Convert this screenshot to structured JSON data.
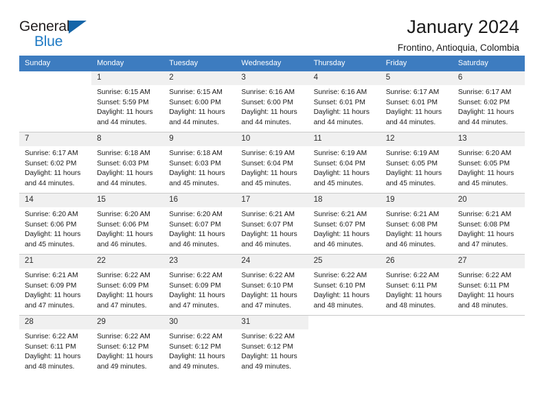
{
  "logo": {
    "line1": "General",
    "line2": "Blue",
    "flag_icon": "blue-triangle-flag",
    "brand_blue": "#1f7ac4",
    "flag_color": "#1565a8"
  },
  "header": {
    "title": "January 2024",
    "location": "Frontino, Antioquia, Colombia",
    "header_bg": "#3d7cc0"
  },
  "weekdays": [
    "Sunday",
    "Monday",
    "Tuesday",
    "Wednesday",
    "Thursday",
    "Friday",
    "Saturday"
  ],
  "weeks": [
    [
      {
        "day": "",
        "sunrise": "",
        "sunset": "",
        "daylight1": "",
        "daylight2": "",
        "empty": true
      },
      {
        "day": "1",
        "sunrise": "Sunrise: 6:15 AM",
        "sunset": "Sunset: 5:59 PM",
        "daylight1": "Daylight: 11 hours",
        "daylight2": "and 44 minutes."
      },
      {
        "day": "2",
        "sunrise": "Sunrise: 6:15 AM",
        "sunset": "Sunset: 6:00 PM",
        "daylight1": "Daylight: 11 hours",
        "daylight2": "and 44 minutes."
      },
      {
        "day": "3",
        "sunrise": "Sunrise: 6:16 AM",
        "sunset": "Sunset: 6:00 PM",
        "daylight1": "Daylight: 11 hours",
        "daylight2": "and 44 minutes."
      },
      {
        "day": "4",
        "sunrise": "Sunrise: 6:16 AM",
        "sunset": "Sunset: 6:01 PM",
        "daylight1": "Daylight: 11 hours",
        "daylight2": "and 44 minutes."
      },
      {
        "day": "5",
        "sunrise": "Sunrise: 6:17 AM",
        "sunset": "Sunset: 6:01 PM",
        "daylight1": "Daylight: 11 hours",
        "daylight2": "and 44 minutes."
      },
      {
        "day": "6",
        "sunrise": "Sunrise: 6:17 AM",
        "sunset": "Sunset: 6:02 PM",
        "daylight1": "Daylight: 11 hours",
        "daylight2": "and 44 minutes."
      }
    ],
    [
      {
        "day": "7",
        "sunrise": "Sunrise: 6:17 AM",
        "sunset": "Sunset: 6:02 PM",
        "daylight1": "Daylight: 11 hours",
        "daylight2": "and 44 minutes."
      },
      {
        "day": "8",
        "sunrise": "Sunrise: 6:18 AM",
        "sunset": "Sunset: 6:03 PM",
        "daylight1": "Daylight: 11 hours",
        "daylight2": "and 44 minutes."
      },
      {
        "day": "9",
        "sunrise": "Sunrise: 6:18 AM",
        "sunset": "Sunset: 6:03 PM",
        "daylight1": "Daylight: 11 hours",
        "daylight2": "and 45 minutes."
      },
      {
        "day": "10",
        "sunrise": "Sunrise: 6:19 AM",
        "sunset": "Sunset: 6:04 PM",
        "daylight1": "Daylight: 11 hours",
        "daylight2": "and 45 minutes."
      },
      {
        "day": "11",
        "sunrise": "Sunrise: 6:19 AM",
        "sunset": "Sunset: 6:04 PM",
        "daylight1": "Daylight: 11 hours",
        "daylight2": "and 45 minutes."
      },
      {
        "day": "12",
        "sunrise": "Sunrise: 6:19 AM",
        "sunset": "Sunset: 6:05 PM",
        "daylight1": "Daylight: 11 hours",
        "daylight2": "and 45 minutes."
      },
      {
        "day": "13",
        "sunrise": "Sunrise: 6:20 AM",
        "sunset": "Sunset: 6:05 PM",
        "daylight1": "Daylight: 11 hours",
        "daylight2": "and 45 minutes."
      }
    ],
    [
      {
        "day": "14",
        "sunrise": "Sunrise: 6:20 AM",
        "sunset": "Sunset: 6:06 PM",
        "daylight1": "Daylight: 11 hours",
        "daylight2": "and 45 minutes."
      },
      {
        "day": "15",
        "sunrise": "Sunrise: 6:20 AM",
        "sunset": "Sunset: 6:06 PM",
        "daylight1": "Daylight: 11 hours",
        "daylight2": "and 46 minutes."
      },
      {
        "day": "16",
        "sunrise": "Sunrise: 6:20 AM",
        "sunset": "Sunset: 6:07 PM",
        "daylight1": "Daylight: 11 hours",
        "daylight2": "and 46 minutes."
      },
      {
        "day": "17",
        "sunrise": "Sunrise: 6:21 AM",
        "sunset": "Sunset: 6:07 PM",
        "daylight1": "Daylight: 11 hours",
        "daylight2": "and 46 minutes."
      },
      {
        "day": "18",
        "sunrise": "Sunrise: 6:21 AM",
        "sunset": "Sunset: 6:07 PM",
        "daylight1": "Daylight: 11 hours",
        "daylight2": "and 46 minutes."
      },
      {
        "day": "19",
        "sunrise": "Sunrise: 6:21 AM",
        "sunset": "Sunset: 6:08 PM",
        "daylight1": "Daylight: 11 hours",
        "daylight2": "and 46 minutes."
      },
      {
        "day": "20",
        "sunrise": "Sunrise: 6:21 AM",
        "sunset": "Sunset: 6:08 PM",
        "daylight1": "Daylight: 11 hours",
        "daylight2": "and 47 minutes."
      }
    ],
    [
      {
        "day": "21",
        "sunrise": "Sunrise: 6:21 AM",
        "sunset": "Sunset: 6:09 PM",
        "daylight1": "Daylight: 11 hours",
        "daylight2": "and 47 minutes."
      },
      {
        "day": "22",
        "sunrise": "Sunrise: 6:22 AM",
        "sunset": "Sunset: 6:09 PM",
        "daylight1": "Daylight: 11 hours",
        "daylight2": "and 47 minutes."
      },
      {
        "day": "23",
        "sunrise": "Sunrise: 6:22 AM",
        "sunset": "Sunset: 6:09 PM",
        "daylight1": "Daylight: 11 hours",
        "daylight2": "and 47 minutes."
      },
      {
        "day": "24",
        "sunrise": "Sunrise: 6:22 AM",
        "sunset": "Sunset: 6:10 PM",
        "daylight1": "Daylight: 11 hours",
        "daylight2": "and 47 minutes."
      },
      {
        "day": "25",
        "sunrise": "Sunrise: 6:22 AM",
        "sunset": "Sunset: 6:10 PM",
        "daylight1": "Daylight: 11 hours",
        "daylight2": "and 48 minutes."
      },
      {
        "day": "26",
        "sunrise": "Sunrise: 6:22 AM",
        "sunset": "Sunset: 6:11 PM",
        "daylight1": "Daylight: 11 hours",
        "daylight2": "and 48 minutes."
      },
      {
        "day": "27",
        "sunrise": "Sunrise: 6:22 AM",
        "sunset": "Sunset: 6:11 PM",
        "daylight1": "Daylight: 11 hours",
        "daylight2": "and 48 minutes."
      }
    ],
    [
      {
        "day": "28",
        "sunrise": "Sunrise: 6:22 AM",
        "sunset": "Sunset: 6:11 PM",
        "daylight1": "Daylight: 11 hours",
        "daylight2": "and 48 minutes."
      },
      {
        "day": "29",
        "sunrise": "Sunrise: 6:22 AM",
        "sunset": "Sunset: 6:12 PM",
        "daylight1": "Daylight: 11 hours",
        "daylight2": "and 49 minutes."
      },
      {
        "day": "30",
        "sunrise": "Sunrise: 6:22 AM",
        "sunset": "Sunset: 6:12 PM",
        "daylight1": "Daylight: 11 hours",
        "daylight2": "and 49 minutes."
      },
      {
        "day": "31",
        "sunrise": "Sunrise: 6:22 AM",
        "sunset": "Sunset: 6:12 PM",
        "daylight1": "Daylight: 11 hours",
        "daylight2": "and 49 minutes."
      },
      {
        "day": "",
        "sunrise": "",
        "sunset": "",
        "daylight1": "",
        "daylight2": "",
        "empty": true
      },
      {
        "day": "",
        "sunrise": "",
        "sunset": "",
        "daylight1": "",
        "daylight2": "",
        "empty": true
      },
      {
        "day": "",
        "sunrise": "",
        "sunset": "",
        "daylight1": "",
        "daylight2": "",
        "empty": true
      }
    ]
  ]
}
